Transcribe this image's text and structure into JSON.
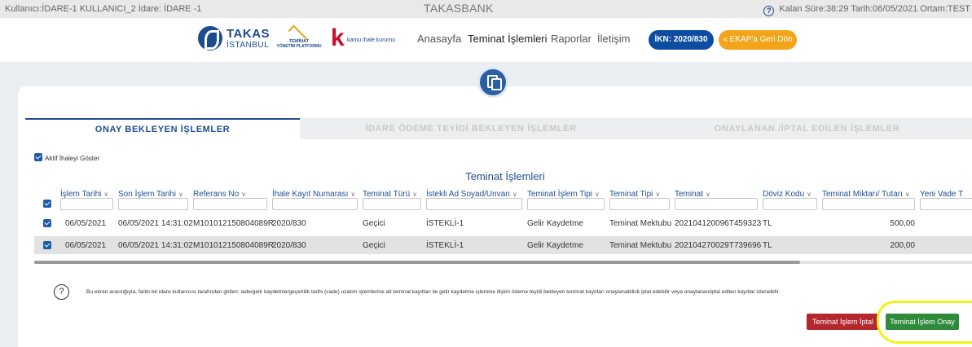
{
  "topbar": {
    "user_info": "Kullanıcı:İDARE-1 KULLANICI_2  İdare: İDARE -1",
    "app_title": "TAKASBANK",
    "session_info": "Kalan Süre:38:29  Tarih:06/05/2021  Ortam:TEST"
  },
  "logos": {
    "takas_line1": "TAKAS",
    "takas_line2": "İSTANBUL",
    "teminat_line1": "TEMİNAT",
    "teminat_line2": "YÖNETİM PLATFORMU",
    "kik_text": "kamu ihale kurumu"
  },
  "nav": {
    "items": [
      "Anasayfa",
      "Teminat İşlemleri",
      "Raporlar",
      "İletişim"
    ],
    "ikn_button": "İKN: 2020/830",
    "ekap_button": "« EKAP'a Geri Dön"
  },
  "tabs": [
    "ONAY BEKLEYEN İŞLEMLER",
    "İDARE ÖDEME TEYİDİ BEKLEYEN İŞLEMLER",
    "ONAYLANAN /İPTAL EDİLEN İŞLEMLER"
  ],
  "filter": {
    "aktif_label": "Aktif İhaleyi Göster"
  },
  "table": {
    "title": "Teminat İşlemleri",
    "columns": [
      "İşlem Tarihi",
      "Son İşlem Tarihi",
      "Referans No",
      "İhale Kayıt Numarası",
      "Teminat Türü",
      "İstekli Ad Soyad/Unvan",
      "Teminat İşlem Tipi",
      "Teminat Tipi",
      "Teminat",
      "Döviz Kodu",
      "Teminat Miktarı/ Tutarı",
      "Yeni Vade T"
    ],
    "rows": [
      [
        "06/05/2021",
        "06/05/2021 14:31:02",
        "M10101215080408​9R",
        "2020/830",
        "Geçici",
        "İSTEKLİ-1",
        "Gelir Kaydetme",
        "Teminat Mektubu",
        "20210412009​6T459323",
        "TL",
        "500,00",
        ""
      ],
      [
        "06/05/2021",
        "06/05/2021 14:31:02",
        "M10101215080408​9R",
        "2020/830",
        "Geçici",
        "İSTEKLİ-1",
        "Gelir Kaydetme",
        "Teminat Mektubu",
        "20210427002​9T739696",
        "TL",
        "200,00",
        ""
      ]
    ]
  },
  "info": {
    "text": "Bu ekran aracılığıyla, farklı bir idare kullanıcısı tarafından girilen; iade/gelir kaydetme/geçerlilik tarihi (vade) uzatım işlemlerine ait teminat kayıtları ile gelir kaydetme işlemine ilişkin ödeme teyidi bekleyen teminat kayıtları onaylanabilir& iptal edebilir veya onaylanan/iptal edilen kayıtlar izlenebilir."
  },
  "actions": {
    "iptal_button": "Teminat İşlem İptal",
    "onay_button": "Teminat İşlem Onay"
  },
  "colors": {
    "brand_blue": "#1f4d91",
    "ikn_blue": "#0d4da1",
    "ekap_orange": "#f2a51b",
    "cancel_red": "#b3272e",
    "approve_green": "#2f8a3c",
    "highlight_yellow": "#f3f21a"
  }
}
